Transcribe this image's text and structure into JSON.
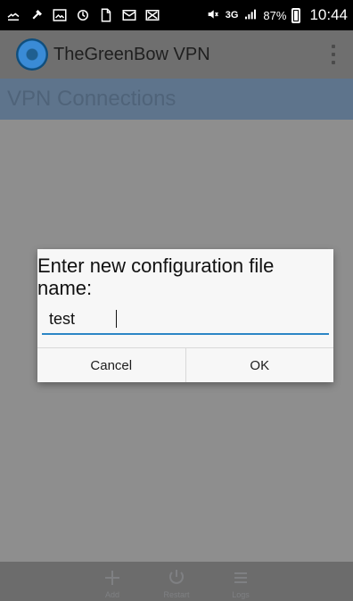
{
  "status_bar": {
    "network_label": "3G",
    "battery_label": "87%",
    "time": "10:44"
  },
  "app_bar": {
    "title": "TheGreenBow VPN"
  },
  "section": {
    "title": "VPN Connections"
  },
  "dialog": {
    "title": "Enter new configuration file name:",
    "input_value": "test",
    "cancel_label": "Cancel",
    "ok_label": "OK",
    "accent_color": "#2c86c6"
  },
  "bottom_bar": {
    "items": [
      {
        "label": "Add",
        "icon": "plus-icon"
      },
      {
        "label": "Restart",
        "icon": "power-icon"
      },
      {
        "label": "Logs",
        "icon": "logs-icon"
      }
    ]
  }
}
